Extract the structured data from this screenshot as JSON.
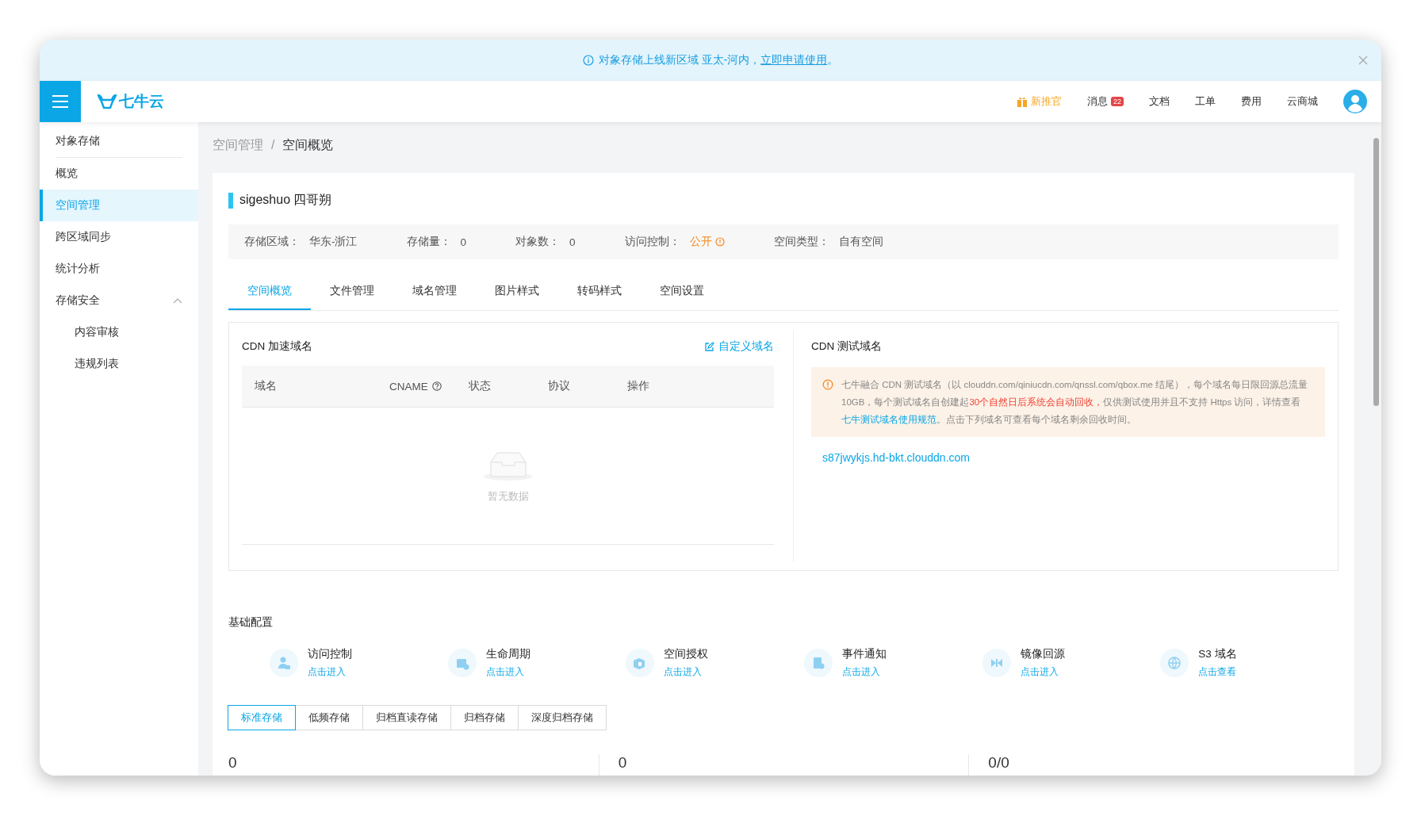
{
  "banner": {
    "text": "对象存储上线新区域 亚太-河内，",
    "link": "立即申请使用",
    "tail": "。"
  },
  "header": {
    "logo": "七牛云",
    "nav": [
      {
        "label": "新推官",
        "kind": "promo"
      },
      {
        "label": "消息",
        "kind": "badge",
        "badge": "22"
      },
      {
        "label": "文档",
        "kind": "plain"
      },
      {
        "label": "工单",
        "kind": "plain"
      },
      {
        "label": "费用",
        "kind": "plain"
      },
      {
        "label": "云商城",
        "kind": "plain"
      }
    ]
  },
  "sidebar": {
    "items": [
      {
        "label": "对象存储",
        "kind": "heading",
        "selected": false
      },
      {
        "label": "概览",
        "kind": "item",
        "selected": false
      },
      {
        "label": "空间管理",
        "kind": "item",
        "selected": true
      },
      {
        "label": "跨区域同步",
        "kind": "item",
        "selected": false
      },
      {
        "label": "统计分析",
        "kind": "item",
        "selected": false
      },
      {
        "label": "存储安全",
        "kind": "group",
        "selected": false,
        "expanded": true,
        "children": [
          {
            "label": "内容审核",
            "selected": false
          },
          {
            "label": "违规列表",
            "selected": false
          }
        ]
      }
    ]
  },
  "breadcrumb": {
    "items": [
      "空间管理",
      "空间概览"
    ],
    "separator": "/"
  },
  "bucket": {
    "title": "sigeshuo 四哥朔",
    "info": [
      {
        "label": "存储区域：",
        "value": "华东-浙江",
        "kind": "plain"
      },
      {
        "label": "存储量：",
        "value": "0",
        "kind": "plain"
      },
      {
        "label": "对象数：",
        "value": "0",
        "kind": "plain"
      },
      {
        "label": "访问控制：",
        "value": "公开",
        "kind": "warning"
      },
      {
        "label": "空间类型：",
        "value": "自有空间",
        "kind": "plain"
      }
    ]
  },
  "tabs": [
    {
      "label": "空间概览",
      "selected": true
    },
    {
      "label": "文件管理",
      "selected": false
    },
    {
      "label": "域名管理",
      "selected": false
    },
    {
      "label": "图片样式",
      "selected": false
    },
    {
      "label": "转码样式",
      "selected": false
    },
    {
      "label": "空间设置",
      "selected": false
    }
  ],
  "cdn_domains": {
    "title": "CDN 加速域名",
    "action": "自定义域名",
    "columns": [
      {
        "label": "域名",
        "help": false
      },
      {
        "label": "CNAME",
        "help": true
      },
      {
        "label": "状态",
        "help": false
      },
      {
        "label": "协议",
        "help": false
      },
      {
        "label": "操作",
        "help": false
      }
    ],
    "empty_text": "暂无数据"
  },
  "test_domains": {
    "title": "CDN 测试域名",
    "notice": [
      {
        "text": "七牛融合 CDN 测试域名（以 clouddn.com/qiniucdn.com/qnssl.com/qbox.me 结尾），每个域名每日限回源总流量 10GB，每个测试域名自创建起",
        "kind": "plain"
      },
      {
        "text": "30个自然日后系统会自动回收，",
        "kind": "danger"
      },
      {
        "text": "仅供测试使用并且不支持 Https 访问，详情查看",
        "kind": "plain"
      },
      {
        "text": "七牛测试域名使用规范",
        "kind": "link"
      },
      {
        "text": "。点击下列域名可查看每个域名剩余回收时间。",
        "kind": "plain"
      }
    ],
    "domains": [
      "s87jwykjs.hd-bkt.clouddn.com"
    ]
  },
  "basic_config": {
    "title": "基础配置",
    "features": [
      {
        "name": "访问控制",
        "action": "点击进入"
      },
      {
        "name": "生命周期",
        "action": "点击进入"
      },
      {
        "name": "空间授权",
        "action": "点击进入"
      },
      {
        "name": "事件通知",
        "action": "点击进入"
      },
      {
        "name": "镜像回源",
        "action": "点击进入"
      },
      {
        "name": "S3 域名",
        "action": "点击查看"
      }
    ]
  },
  "storage_tabs": [
    {
      "label": "标准存储",
      "selected": true
    },
    {
      "label": "低频存储",
      "selected": false
    },
    {
      "label": "归档直读存储",
      "selected": false
    },
    {
      "label": "归档存储",
      "selected": false
    },
    {
      "label": "深度归档存储",
      "selected": false
    }
  ],
  "stats": [
    "0",
    "0",
    "0/0"
  ]
}
